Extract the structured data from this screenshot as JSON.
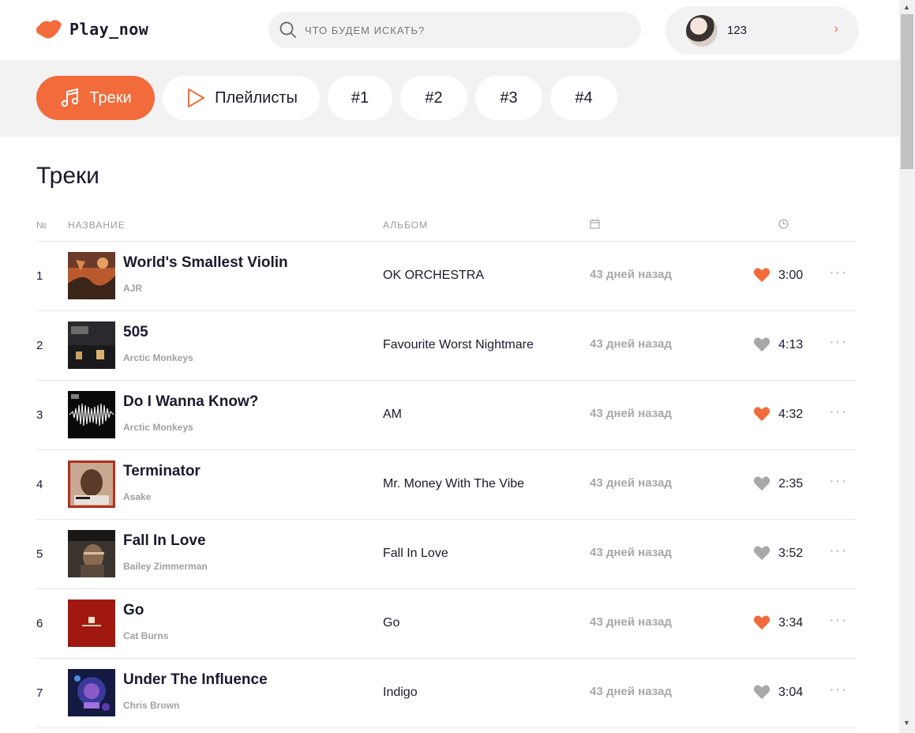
{
  "app": {
    "logo_text": "Play_now",
    "brand_color": "#f26b3a"
  },
  "search": {
    "placeholder": "ЧТО БУДЕМ ИСКАТЬ?",
    "value": ""
  },
  "user": {
    "name": "123",
    "arrow": "›"
  },
  "tabs": [
    {
      "label": "Треки",
      "icon": "music-note-icon",
      "active": true
    },
    {
      "label": "Плейлисты",
      "icon": "play-icon",
      "active": false
    },
    {
      "label": "#1",
      "active": false
    },
    {
      "label": "#2",
      "active": false
    },
    {
      "label": "#3",
      "active": false
    },
    {
      "label": "#4",
      "active": false
    }
  ],
  "page_title": "Треки",
  "table": {
    "headers": {
      "num": "№",
      "title": "НАЗВАНИЕ",
      "album": "АЛЬБОМ",
      "date_icon": "calendar-icon",
      "duration_icon": "clock-icon"
    },
    "rows": [
      {
        "num": "1",
        "title": "World's Smallest Violin",
        "artist": "AJR",
        "album": "OK ORCHESTRA",
        "date": "43 дней назад",
        "liked": true,
        "duration": "3:00"
      },
      {
        "num": "2",
        "title": "505",
        "artist": "Arctic Monkeys",
        "album": "Favourite Worst Nightmare",
        "date": "43 дней назад",
        "liked": false,
        "duration": "4:13"
      },
      {
        "num": "3",
        "title": "Do I Wanna Know?",
        "artist": "Arctic Monkeys",
        "album": "AM",
        "date": "43 дней назад",
        "liked": true,
        "duration": "4:32"
      },
      {
        "num": "4",
        "title": "Terminator",
        "artist": "Asake",
        "album": "Mr. Money With The Vibe",
        "date": "43 дней назад",
        "liked": false,
        "duration": "2:35"
      },
      {
        "num": "5",
        "title": "Fall In Love",
        "artist": "Bailey Zimmerman",
        "album": "Fall In Love",
        "date": "43 дней назад",
        "liked": false,
        "duration": "3:52"
      },
      {
        "num": "6",
        "title": "Go",
        "artist": "Cat Burns",
        "album": "Go",
        "date": "43 дней назад",
        "liked": true,
        "duration": "3:34"
      },
      {
        "num": "7",
        "title": "Under The Influence",
        "artist": "Chris Brown",
        "album": "Indigo",
        "date": "43 дней назад",
        "liked": false,
        "duration": "3:04"
      }
    ],
    "more_label": "···"
  },
  "colors": {
    "liked": "#f26b3a",
    "unliked": "#a8a8a8"
  }
}
